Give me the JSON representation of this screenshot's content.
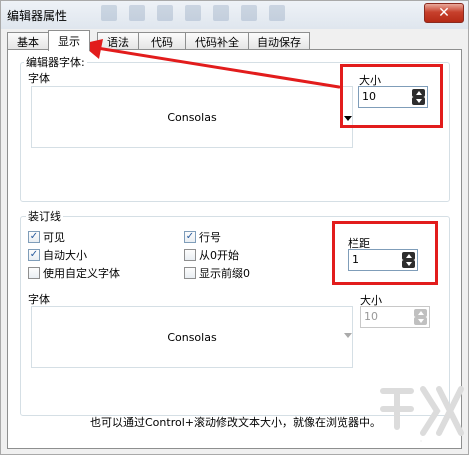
{
  "window": {
    "title": "编辑器属性",
    "close_glyph": "✕"
  },
  "tabs": [
    {
      "label": "基本"
    },
    {
      "label": "显示"
    },
    {
      "label": "语法"
    },
    {
      "label": "代码"
    },
    {
      "label": "代码补全"
    },
    {
      "label": "自动保存"
    }
  ],
  "active_tab": "显示",
  "editor_font": {
    "group_label": "编辑器字体:",
    "font_label": "字体",
    "font_value": "Consolas",
    "size_label": "大小",
    "size_value": "10"
  },
  "binding": {
    "group_label": "装订线",
    "checkboxes": [
      {
        "label": "可见",
        "checked": true,
        "mark": "✓"
      },
      {
        "label": "自动大小",
        "checked": true,
        "mark": "✓"
      },
      {
        "label": "使用自定义字体",
        "checked": false,
        "mark": ""
      },
      {
        "label": "行号",
        "checked": true,
        "mark": "✓"
      },
      {
        "label": "从0开始",
        "checked": false,
        "mark": ""
      },
      {
        "label": "显示前缀0",
        "checked": false,
        "mark": ""
      }
    ],
    "margin_label": "栏距",
    "margin_value": "1",
    "font_label": "字体",
    "font_value": "Consolas",
    "size_label": "大小",
    "size_value": "10"
  },
  "hint": "也可以通过Control+滚动修改文本大小，就像在浏览器中。",
  "colors": {
    "annotation_red": "#e21c1c",
    "tab_border": "#8e8f8f",
    "group_border": "#d5dfe5"
  },
  "icons": {
    "close": "close-icon",
    "dropdown": "chevron-down-icon",
    "spin_up": "arrow-up-icon",
    "spin_down": "arrow-down-icon",
    "check": "check-icon"
  }
}
